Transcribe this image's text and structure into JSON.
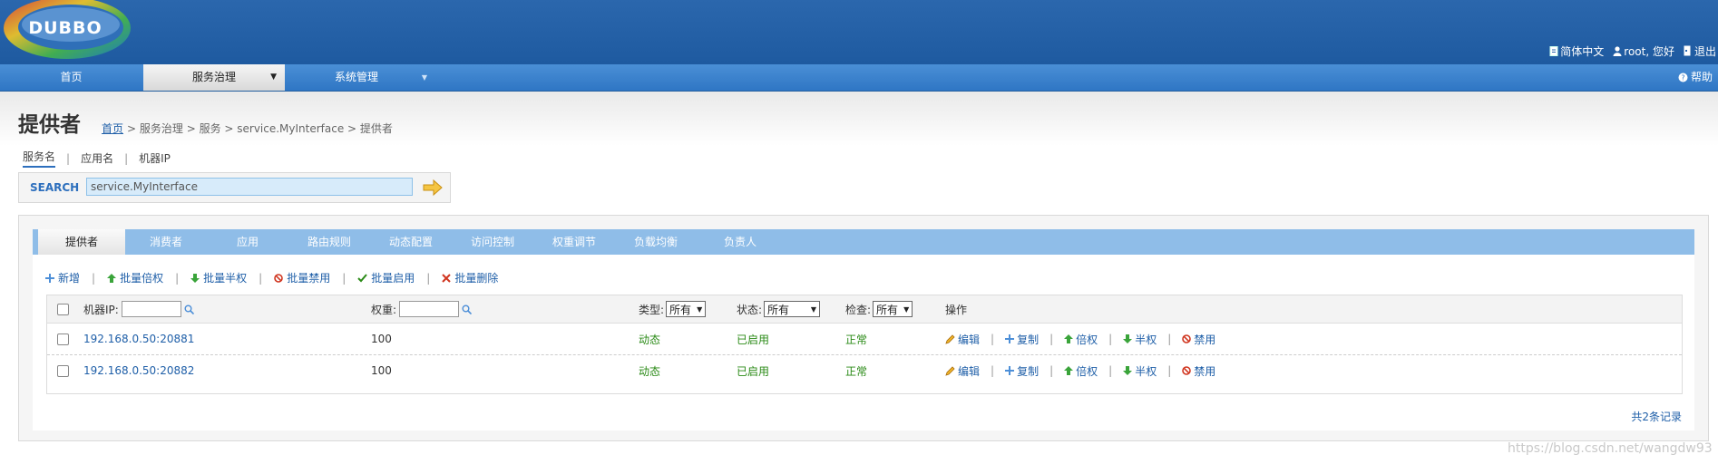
{
  "header": {
    "logo_text": "DUBBO",
    "links": [
      {
        "label": "简体中文",
        "icon": "document-icon"
      },
      {
        "label": "root, 您好",
        "icon": "user-icon"
      },
      {
        "label": "退出",
        "icon": "logout-icon"
      }
    ]
  },
  "nav": {
    "items": [
      {
        "label": "首页"
      },
      {
        "label": "服务治理",
        "active": true
      },
      {
        "label": "系统管理"
      }
    ],
    "help": "帮助"
  },
  "page": {
    "title": "提供者",
    "breadcrumb": {
      "home": "首页",
      "rest": "> 服务治理 > 服务 > service.MyInterface > 提供者"
    }
  },
  "search": {
    "tabs": [
      "服务名",
      "应用名",
      "机器IP"
    ],
    "label": "SEARCH",
    "value": "service.MyInterface"
  },
  "tabs": [
    "提供者",
    "消费者",
    "应用",
    "路由规则",
    "动态配置",
    "访问控制",
    "权重调节",
    "负载均衡",
    "负责人"
  ],
  "actions": [
    {
      "label": "新增",
      "icon": "plus-icon"
    },
    {
      "label": "批量倍权",
      "icon": "arrow-up-icon"
    },
    {
      "label": "批量半权",
      "icon": "arrow-down-icon"
    },
    {
      "label": "批量禁用",
      "icon": "ban-icon"
    },
    {
      "label": "批量启用",
      "icon": "check-icon"
    },
    {
      "label": "批量删除",
      "icon": "delete-x-icon"
    }
  ],
  "table": {
    "headers": {
      "ip": "机器IP:",
      "weight": "权重:",
      "type": "类型:",
      "type_value": "所有",
      "status": "状态:",
      "status_value": "所有",
      "check": "检查:",
      "check_value": "所有",
      "ops": "操作"
    },
    "rows": [
      {
        "ip": "192.168.0.50:20881",
        "weight": "100",
        "type": "动态",
        "status": "已启用",
        "check": "正常"
      },
      {
        "ip": "192.168.0.50:20882",
        "weight": "100",
        "type": "动态",
        "status": "已启用",
        "check": "正常"
      }
    ],
    "ops": [
      {
        "label": "编辑",
        "icon": "pencil-icon"
      },
      {
        "label": "复制",
        "icon": "plus-icon"
      },
      {
        "label": "倍权",
        "icon": "arrow-up-icon"
      },
      {
        "label": "半权",
        "icon": "arrow-down-icon"
      },
      {
        "label": "禁用",
        "icon": "ban-icon"
      }
    ],
    "total": "共2条记录"
  },
  "watermark": "https://blog.csdn.net/wangdw93",
  "colors": {
    "header_blue": "#1e5aa0",
    "nav_blue": "#3a80cb",
    "tab_blue": "#8fbde8",
    "link_blue": "#1f5fa8",
    "status_green": "#2a8a16",
    "ban_red": "#d0351f"
  }
}
